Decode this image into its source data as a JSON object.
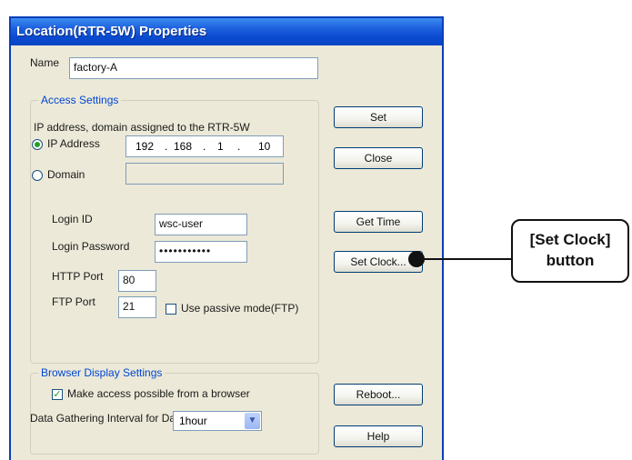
{
  "window": {
    "title": "Location(RTR-5W) Properties"
  },
  "name_field": {
    "label": "Name",
    "value": "factory-A"
  },
  "access_settings": {
    "title": "Access Settings",
    "description": "IP address, domain assigned to the RTR-5W",
    "ip_radio_label": "IP Address",
    "domain_radio_label": "Domain",
    "ip_octets": [
      "192",
      "168",
      "1",
      "10"
    ],
    "ip_separator": ".",
    "domain_value": "",
    "login_id_label": "Login ID",
    "login_id_value": "wsc-user",
    "login_password_label": "Login Password",
    "login_password_value": "•••••••••••",
    "http_port_label": "HTTP Port",
    "http_port_value": "80",
    "ftp_port_label": "FTP Port",
    "ftp_port_value": "21",
    "passive_mode_label": "Use passive mode(FTP)",
    "passive_mode_checked": false,
    "selected_mode": "IP Address"
  },
  "browser_settings": {
    "title": "Browser Display Settings",
    "make_access_label": "Make access possible from a browser",
    "make_access_checked": true,
    "interval_label": "Data Gathering Interval for Data Transfer Graph",
    "interval_value": "1hour"
  },
  "buttons": {
    "set": "Set",
    "close": "Close",
    "get_time": "Get Time",
    "set_clock": "Set Clock...",
    "reboot": "Reboot...",
    "help": "Help"
  },
  "callout": {
    "line1": "[Set Clock]",
    "line2": "button"
  },
  "colors": {
    "title_bar": "#1f63e0",
    "group_title": "#0046d5",
    "dialog_bg": "#ece9d8"
  }
}
